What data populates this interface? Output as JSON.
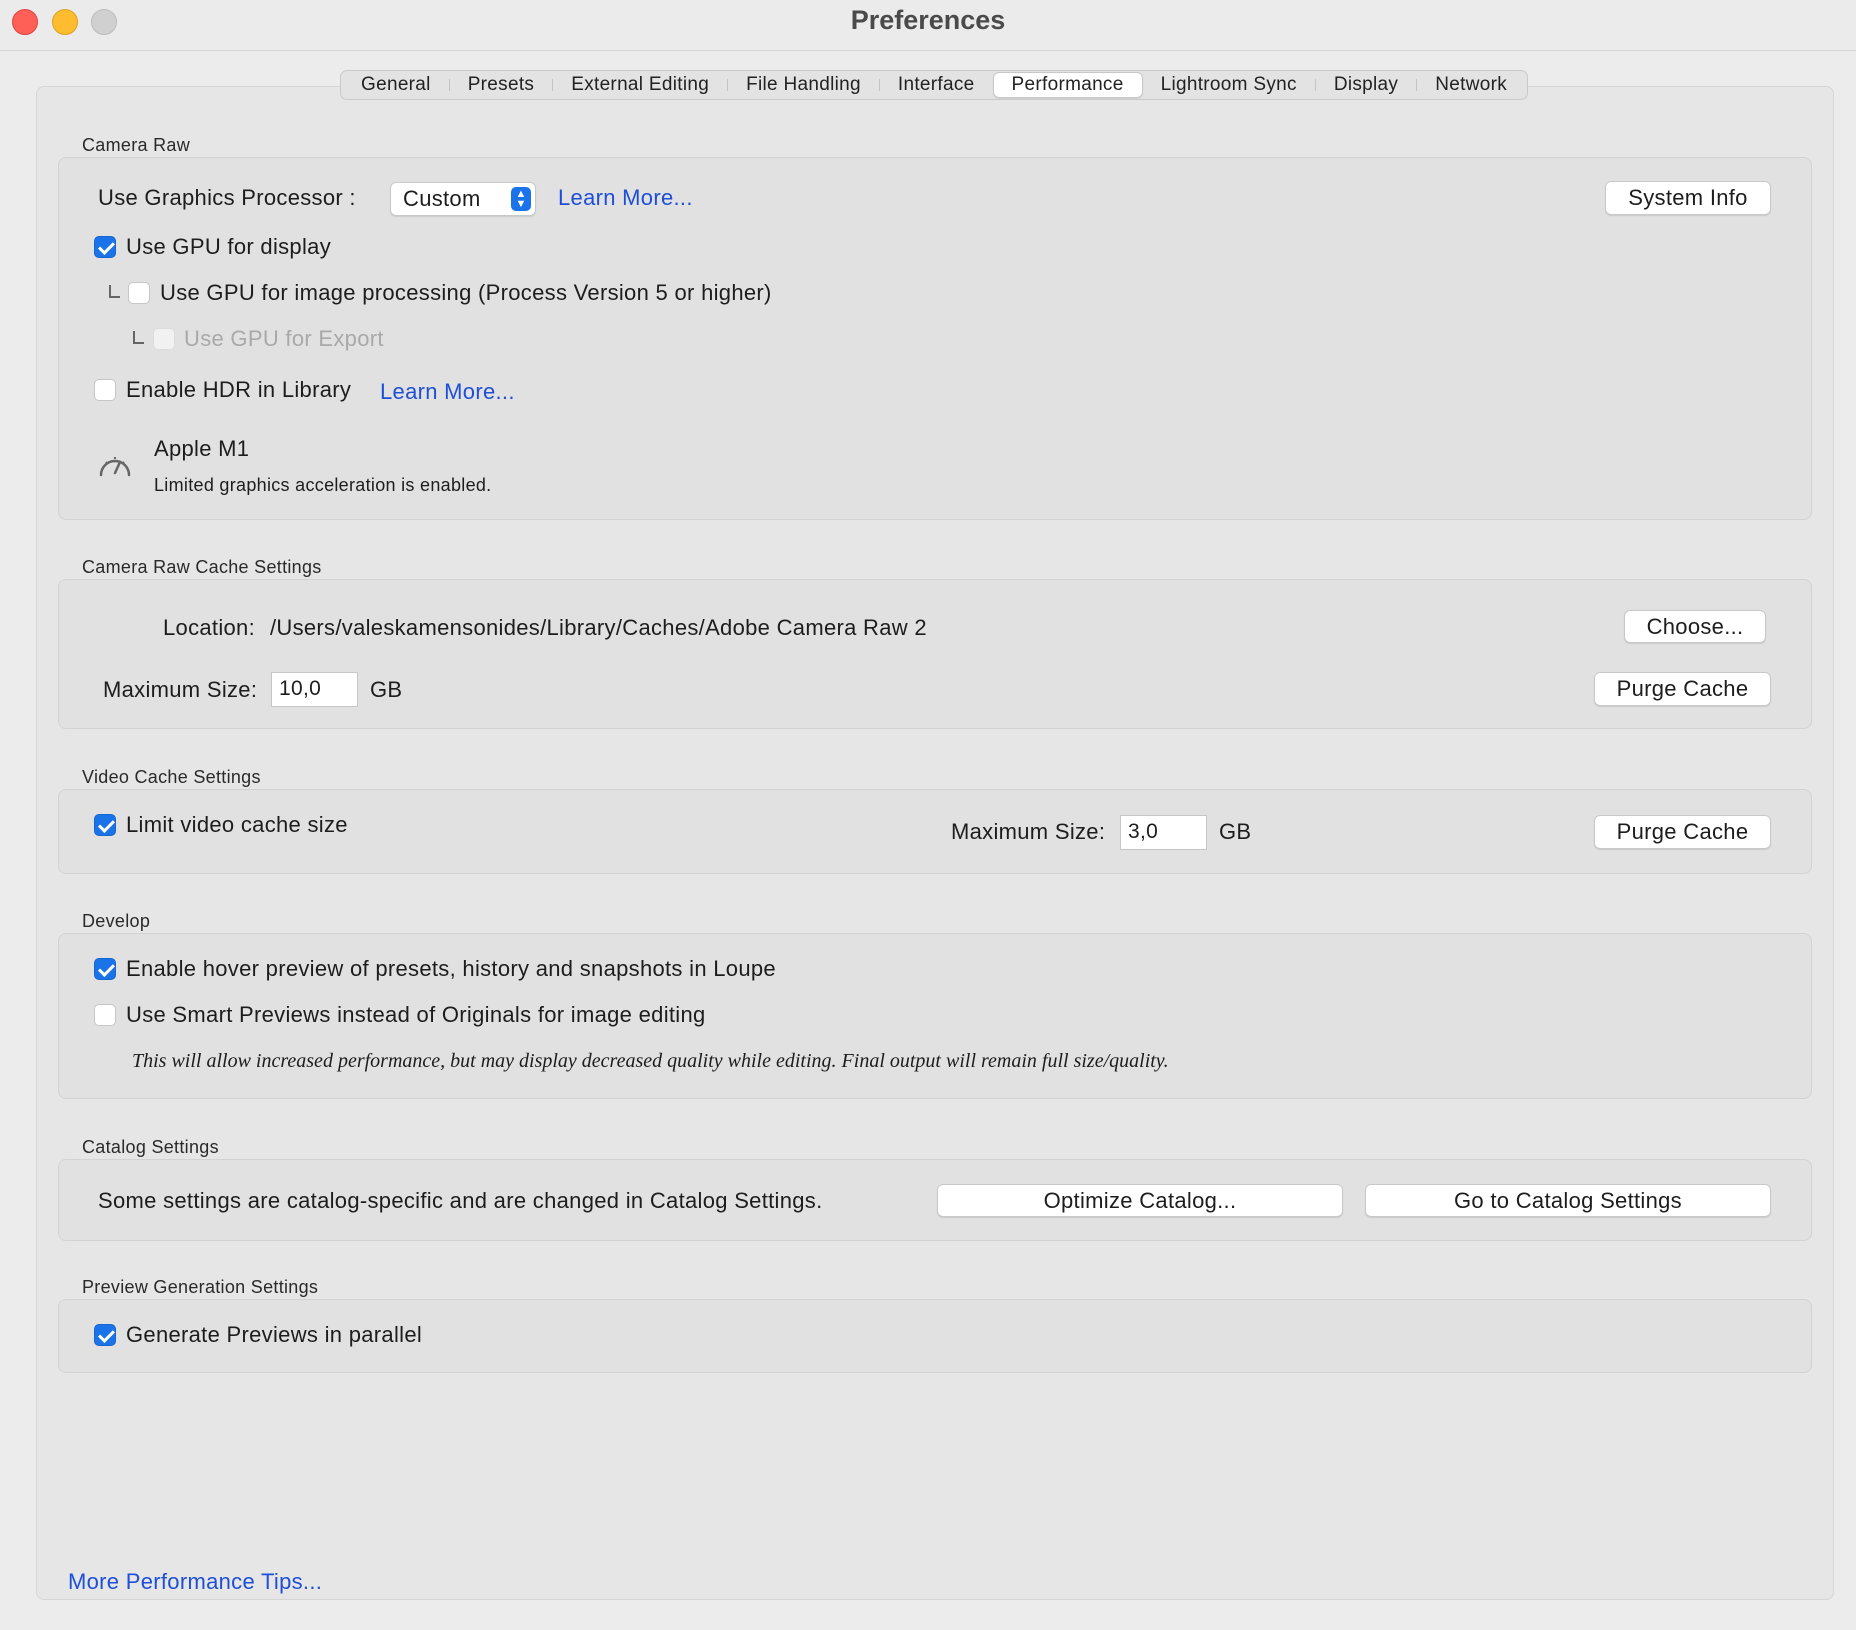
{
  "window": {
    "title": "Preferences"
  },
  "tabs": [
    {
      "label": "General"
    },
    {
      "label": "Presets"
    },
    {
      "label": "External Editing"
    },
    {
      "label": "File Handling"
    },
    {
      "label": "Interface"
    },
    {
      "label": "Performance",
      "active": true
    },
    {
      "label": "Lightroom Sync"
    },
    {
      "label": "Display"
    },
    {
      "label": "Network"
    }
  ],
  "camera_raw": {
    "section_label": "Camera Raw",
    "gpu_label": "Use Graphics Processor :",
    "gpu_select": "Custom",
    "learn_more": "Learn More...",
    "system_info": "System Info",
    "use_gpu_display": {
      "label": "Use GPU for display",
      "checked": true
    },
    "use_gpu_processing": {
      "label": "Use GPU for image processing (Process Version 5 or higher)",
      "checked": false
    },
    "use_gpu_export": {
      "label": "Use GPU for Export",
      "checked": false,
      "disabled": true
    },
    "enable_hdr": {
      "label": "Enable HDR in Library",
      "checked": false
    },
    "hdr_learn_more": "Learn More...",
    "gpu_name": "Apple M1",
    "gpu_status": "Limited graphics acceleration is enabled."
  },
  "cache": {
    "section_label": "Camera Raw Cache Settings",
    "location_label": "Location:",
    "location_path": "/Users/valeskamensonides/Library/Caches/Adobe Camera Raw 2",
    "choose": "Choose...",
    "max_size_label": "Maximum Size:",
    "max_size_value": "10,0",
    "unit": "GB",
    "purge": "Purge Cache"
  },
  "video_cache": {
    "section_label": "Video Cache Settings",
    "limit": {
      "label": "Limit video cache size",
      "checked": true
    },
    "max_size_label": "Maximum Size:",
    "max_size_value": "3,0",
    "unit": "GB",
    "purge": "Purge Cache"
  },
  "develop": {
    "section_label": "Develop",
    "hover_preview": {
      "label": "Enable hover preview of presets, history and snapshots in Loupe",
      "checked": true
    },
    "smart_previews": {
      "label": "Use Smart Previews instead of Originals for image editing",
      "checked": false
    },
    "note": "This will allow increased performance, but may display decreased quality while editing. Final output will remain full size/quality."
  },
  "catalog": {
    "section_label": "Catalog Settings",
    "text": "Some settings are catalog-specific and are changed in Catalog Settings.",
    "optimize": "Optimize Catalog...",
    "goto": "Go to Catalog Settings"
  },
  "preview_gen": {
    "section_label": "Preview Generation Settings",
    "parallel": {
      "label": "Generate Previews in parallel",
      "checked": true
    }
  },
  "footer": {
    "tips_link": "More Performance Tips..."
  },
  "colors": {
    "accent": "#1a73e8",
    "link": "#1e4fd8",
    "close": "#fe5f57",
    "minimize": "#febc2e"
  }
}
